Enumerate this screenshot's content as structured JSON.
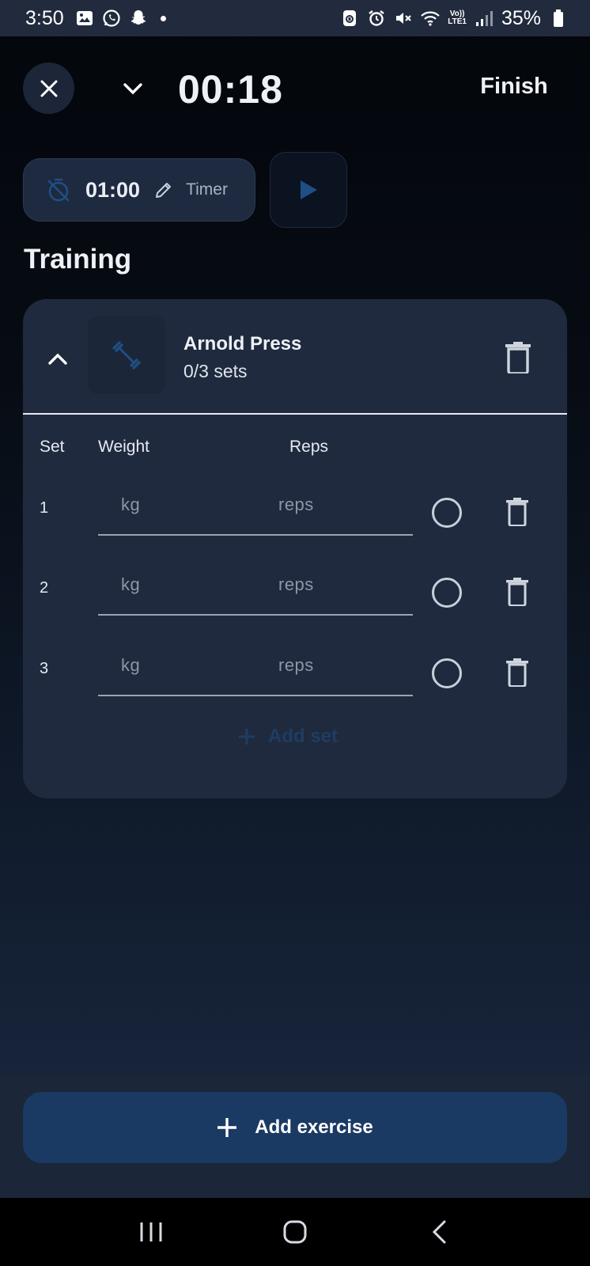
{
  "status_bar": {
    "time": "3:50",
    "network_label_top": "Vo))",
    "network_label_bottom": "LTE1",
    "battery": "35%"
  },
  "header": {
    "elapsed": "00:18",
    "finish_label": "Finish"
  },
  "rest_timer": {
    "value": "01:00",
    "label": "Timer"
  },
  "section_title": "Training",
  "exercise": {
    "name": "Arnold Press",
    "progress": "0/3 sets",
    "columns": {
      "set": "Set",
      "weight": "Weight",
      "reps": "Reps"
    },
    "sets": [
      {
        "number": "1",
        "weight_placeholder": "kg",
        "reps_placeholder": "reps"
      },
      {
        "number": "2",
        "weight_placeholder": "kg",
        "reps_placeholder": "reps"
      },
      {
        "number": "3",
        "weight_placeholder": "kg",
        "reps_placeholder": "reps"
      }
    ],
    "add_set_label": "Add set"
  },
  "add_exercise_label": "Add exercise",
  "colors": {
    "accent_dark_blue": "#1a3a63",
    "card_bg": "#1f2a3e",
    "play_icon": "#1e4f85"
  },
  "icons": {
    "close": "close-icon",
    "minimize": "chevron-down-icon",
    "timer_off": "timer-off-icon",
    "edit": "pencil-icon",
    "play": "play-icon",
    "collapse": "chevron-up-icon",
    "exercise": "dumbbell-icon",
    "delete": "trash-icon",
    "complete": "circle-check-icon",
    "add": "plus-icon"
  }
}
